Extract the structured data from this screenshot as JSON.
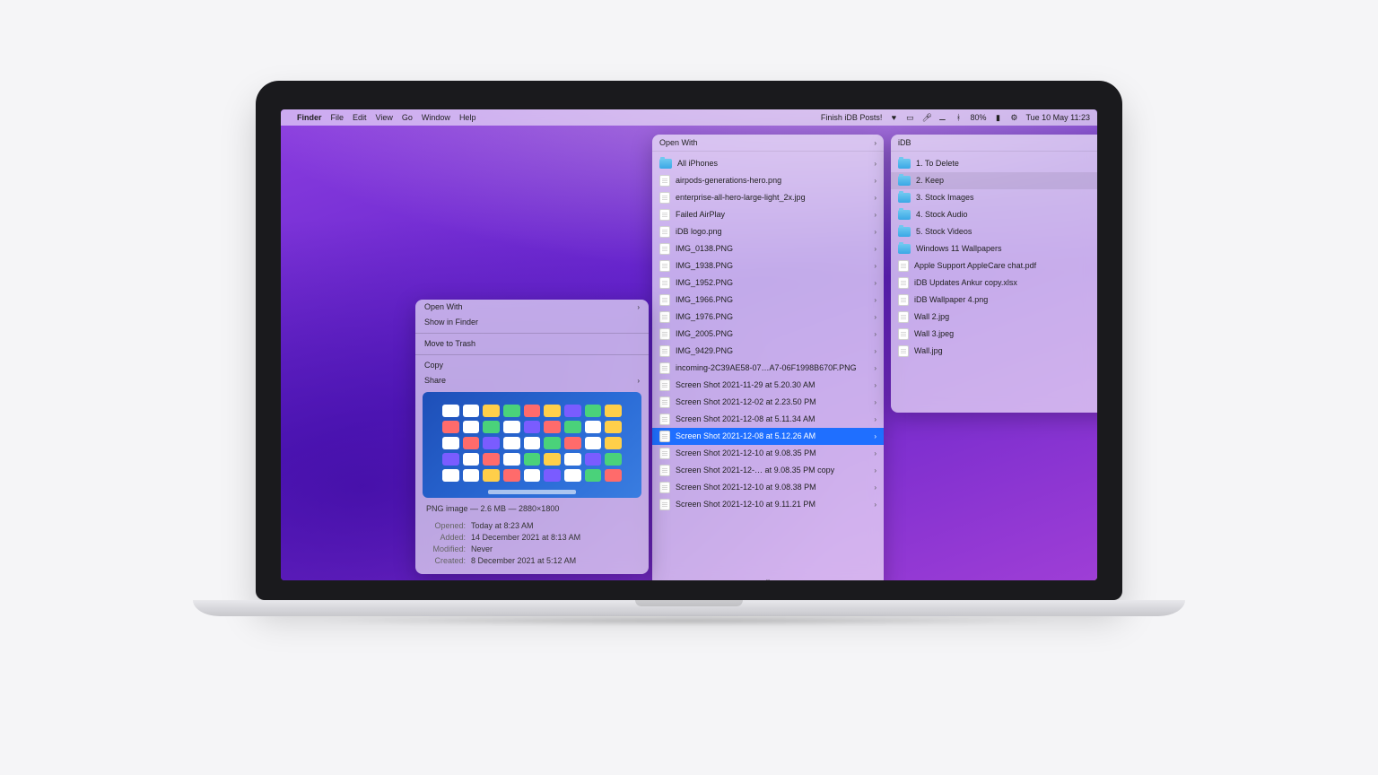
{
  "menubar": {
    "app": "Finder",
    "items": [
      "File",
      "Edit",
      "View",
      "Go",
      "Window",
      "Help"
    ],
    "right_text": "Finish iDB Posts!",
    "battery": "80%",
    "clock": "Tue 10 May  11:23"
  },
  "context_menu": {
    "open_with": "Open With",
    "show_in_finder": "Show in Finder",
    "move_to_trash": "Move to Trash",
    "copy": "Copy",
    "share": "Share",
    "summary": "PNG image   —   2.6 MB   —   2880×1800",
    "opened_k": "Opened:",
    "opened_v": "Today at 8:23 AM",
    "added_k": "Added:",
    "added_v": "14 December 2021 at 8:13 AM",
    "modified_k": "Modified:",
    "modified_v": "Never",
    "created_k": "Created:",
    "created_v": "8 December 2021 at 5:12 AM"
  },
  "col1": {
    "title": "Open With",
    "items": [
      {
        "t": "folder",
        "n": "All iPhones"
      },
      {
        "t": "file",
        "n": "airpods-generations-hero.png"
      },
      {
        "t": "file",
        "n": "enterprise-all-hero-large-light_2x.jpg"
      },
      {
        "t": "file",
        "n": "Failed AirPlay"
      },
      {
        "t": "file",
        "n": "iDB logo.png"
      },
      {
        "t": "file",
        "n": "IMG_0138.PNG"
      },
      {
        "t": "file",
        "n": "IMG_1938.PNG"
      },
      {
        "t": "file",
        "n": "IMG_1952.PNG"
      },
      {
        "t": "file",
        "n": "IMG_1966.PNG"
      },
      {
        "t": "file",
        "n": "IMG_1976.PNG"
      },
      {
        "t": "file",
        "n": "IMG_2005.PNG"
      },
      {
        "t": "file",
        "n": "IMG_9429.PNG"
      },
      {
        "t": "file",
        "n": "incoming-2C39AE58-07…A7-06F1998B670F.PNG"
      },
      {
        "t": "file",
        "n": "Screen Shot 2021-11-29 at 5.20.30 AM"
      },
      {
        "t": "file",
        "n": "Screen Shot 2021-12-02 at 2.23.50 PM"
      },
      {
        "t": "file",
        "n": "Screen Shot 2021-12-08 at 5.11.34 AM"
      },
      {
        "t": "file",
        "n": "Screen Shot 2021-12-08 at 5.12.26 AM",
        "sel": true
      },
      {
        "t": "file",
        "n": "Screen Shot 2021-12-10 at 9.08.35 PM"
      },
      {
        "t": "file",
        "n": "Screen Shot 2021-12-… at 9.08.35 PM copy"
      },
      {
        "t": "file",
        "n": "Screen Shot 2021-12-10 at 9.08.38 PM"
      },
      {
        "t": "file",
        "n": "Screen Shot 2021-12-10 at 9.11.21 PM"
      }
    ]
  },
  "col2": {
    "title": "iDB",
    "items": [
      {
        "t": "folder",
        "n": "1. To Delete"
      },
      {
        "t": "folder",
        "n": "2. Keep",
        "hl": true
      },
      {
        "t": "folder",
        "n": "3. Stock Images"
      },
      {
        "t": "folder",
        "n": "4. Stock Audio"
      },
      {
        "t": "folder",
        "n": "5. Stock Videos"
      },
      {
        "t": "folder",
        "n": "Windows 11 Wallpapers"
      },
      {
        "t": "file",
        "n": "Apple Support AppleCare chat.pdf"
      },
      {
        "t": "file",
        "n": "iDB Updates Ankur copy.xlsx"
      },
      {
        "t": "file",
        "n": "iDB Wallpaper 4.png"
      },
      {
        "t": "file",
        "n": "Wall 2.jpg"
      },
      {
        "t": "file",
        "n": "Wall 3.jpeg"
      },
      {
        "t": "file",
        "n": "Wall.jpg"
      }
    ]
  }
}
